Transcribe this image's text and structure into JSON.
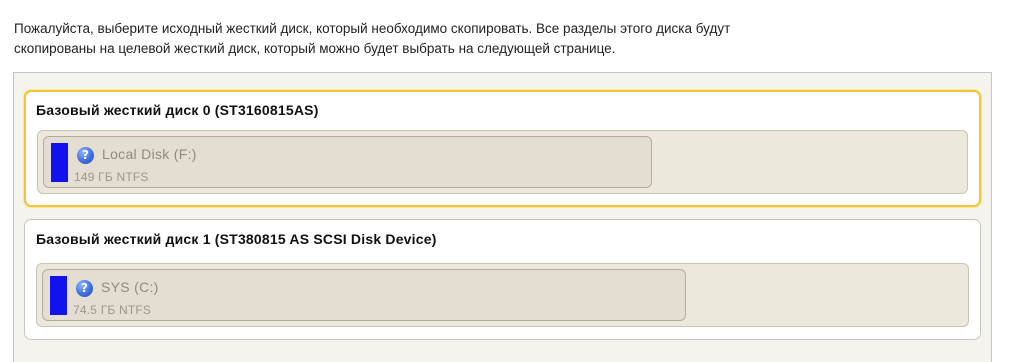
{
  "instructions": {
    "line1": "Пожалуйста, выберите исходный жесткий диск, который необходимо скопировать. Все разделы этого диска будут",
    "line2": "скопированы на целевой жесткий диск, который можно будет выбрать на следующей странице."
  },
  "disks": [
    {
      "title": "Базовый жесткий диск 0 (ST3160815AS)",
      "selected": true,
      "partitions": [
        {
          "icon": "help-icon",
          "icon_glyph": "?",
          "name": "Local Disk (F:)",
          "size": "149 ГБ NTFS",
          "color": "#1212ee"
        }
      ]
    },
    {
      "title": "Базовый жесткий диск 1 (ST380815 AS SCSI Disk Device)",
      "selected": false,
      "partitions": [
        {
          "icon": "help-icon",
          "icon_glyph": "?",
          "name": "SYS (C:)",
          "size": "74.5 ГБ NTFS",
          "color": "#1212ee"
        }
      ]
    }
  ],
  "colors": {
    "selection_border": "#f2c531",
    "partition_fill": "#e3ded1",
    "panel_border": "#b9c9d8"
  }
}
